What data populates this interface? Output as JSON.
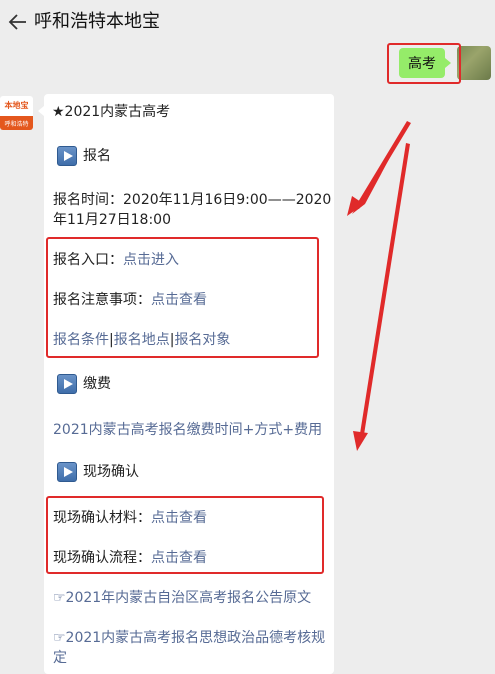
{
  "header": {
    "title": "呼和浩特本地宝"
  },
  "sent_message": {
    "text": "高考"
  },
  "bot": {
    "avatar_top": "本地宝",
    "avatar_bottom": "呼和浩特"
  },
  "article": {
    "heading": "★2021内蒙古高考",
    "section_register": "报名",
    "register_time_line1": "报名时间：2020年11月16日9:00——2020",
    "register_time_line2": "年11月27日18:00",
    "register_entry_label": "报名入口：",
    "register_entry_link": "点击进入",
    "register_notice_label": "报名注意事项：",
    "register_notice_link": "点击查看",
    "register_links": {
      "conditions": "报名条件",
      "sep1": "|",
      "locations": "报名地点",
      "sep2": "|",
      "targets": "报名对象"
    },
    "section_fee": "缴费",
    "fee_link": "2021内蒙古高考报名缴费时间+方式+费用",
    "section_confirm": "现场确认",
    "confirm_materials_label": "现场确认材料：",
    "confirm_materials_link": "点击查看",
    "confirm_process_label": "现场确认流程：",
    "confirm_process_link": "点击查看",
    "announcement_link": "☞2021年内蒙古自治区高考报名公告原文",
    "ideology_link_line1": "☞2021内蒙古高考报名思想政治品德考核规",
    "ideology_link_line2": "定"
  },
  "colors": {
    "link": "#576b95",
    "bubble": "#95ec69",
    "annotation": "#e02a2a"
  }
}
